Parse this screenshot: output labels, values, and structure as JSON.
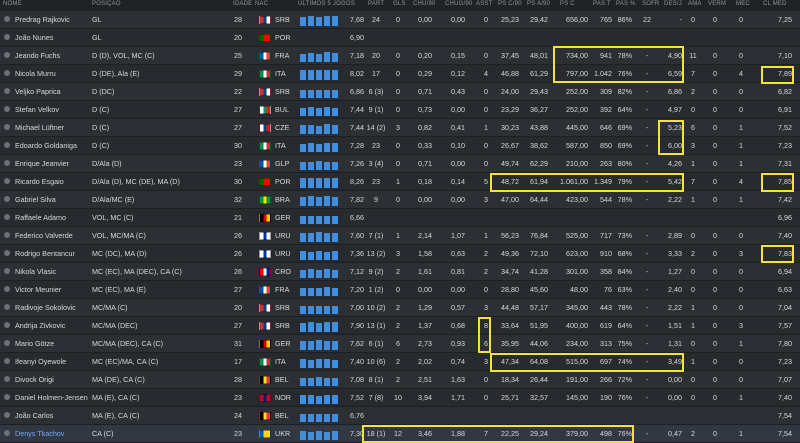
{
  "headers": {
    "name": "NOME",
    "pos": "POSIÇÃO",
    "age": "IDADE",
    "nat": "NAC",
    "last5": "ÚLTIMOS 5 JOGOS",
    "apps": "PART",
    "gls": "GLS",
    "shots90": "CHU/90",
    "sot90": "CHUG/90",
    "ast": "ASST",
    "psc90": "PS C/90",
    "psa90": "PS A/90",
    "psc": "PS C",
    "pst": "PAS T",
    "pspct": "PAS %",
    "sofr": "SOFR",
    "desj": "DES/J",
    "ama": "AMA",
    "verm": "VERM",
    "mec": "MEC",
    "clmed": "CL MED"
  },
  "flag_colors": {
    "SRB": [
      "#c6363c",
      "#0c4076",
      "#ffffff"
    ],
    "POR": [
      "#006600",
      "#ff0000",
      "#ff0000"
    ],
    "FRA": [
      "#0055a4",
      "#ffffff",
      "#ef4135"
    ],
    "ITA": [
      "#009246",
      "#ffffff",
      "#ce2b37"
    ],
    "BUL": [
      "#ffffff",
      "#00966e",
      "#d62612"
    ],
    "CZE": [
      "#ffffff",
      "#11457e",
      "#d7141a"
    ],
    "GLP": [
      "#0055a4",
      "#ffffff",
      "#ef4135"
    ],
    "BRA": [
      "#009c3b",
      "#ffdf00",
      "#009c3b"
    ],
    "GER": [
      "#000000",
      "#dd0000",
      "#ffce00"
    ],
    "URU": [
      "#ffffff",
      "#0038a8",
      "#ffffff"
    ],
    "CRO": [
      "#ff0000",
      "#ffffff",
      "#171796"
    ],
    "BEL": [
      "#000000",
      "#fdda24",
      "#ef3340"
    ],
    "NOR": [
      "#ba0c2f",
      "#00205b",
      "#ba0c2f"
    ],
    "UKR": [
      "#0057b7",
      "#ffd700",
      "#ffd700"
    ]
  },
  "rows": [
    {
      "name": "Predrag Rajkovic",
      "pos": "GL",
      "age": "28",
      "nat": "SRB",
      "last5": [
        0.75,
        0.8,
        0.75,
        0.85,
        0.8
      ],
      "form": "7,68",
      "apps": "24",
      "gls": "0",
      "shots90": "0,00",
      "sot90": "0,00",
      "ast": "0",
      "psc90": "25,23",
      "psa90": "29,42",
      "psc": "656,00",
      "pst": "765",
      "pspct": "86%",
      "sofr": "22",
      "desj": "-",
      "ama": "0",
      "verm": "0",
      "mec": "0",
      "clmed": "7,25"
    },
    {
      "name": "João Nunes",
      "pos": "GL",
      "age": "20",
      "nat": "POR",
      "last5": [
        0,
        0,
        0,
        0,
        0
      ],
      "form": "6,90",
      "apps": "",
      "gls": "",
      "shots90": "",
      "sot90": "",
      "ast": "",
      "psc90": "",
      "psa90": "",
      "psc": "",
      "pst": "",
      "pspct": "",
      "sofr": "",
      "desj": "",
      "ama": "",
      "verm": "",
      "mec": "",
      "clmed": ""
    },
    {
      "name": "Jeando Fuchs",
      "pos": "D (D), VOL, MC (C)",
      "age": "25",
      "nat": "FRA",
      "last5": [
        0.7,
        0.75,
        0.7,
        0.8,
        0.75
      ],
      "form": "7,18",
      "apps": "20",
      "gls": "0",
      "shots90": "0,20",
      "sot90": "0,15",
      "ast": "0",
      "psc90": "37,45",
      "psa90": "48,01",
      "psc": "734,00",
      "pst": "941",
      "pspct": "78%",
      "sofr": "-",
      "desj": "4,90",
      "ama": "11",
      "verm": "0",
      "mec": "0",
      "clmed": "7,10"
    },
    {
      "name": "Nicola Murru",
      "pos": "D (DE), Ala (E)",
      "age": "29",
      "nat": "ITA",
      "last5": [
        0.8,
        0.85,
        0.8,
        0.85,
        0.8
      ],
      "form": "8,02",
      "apps": "17",
      "gls": "0",
      "shots90": "0,29",
      "sot90": "0,12",
      "ast": "4",
      "psc90": "46,88",
      "psa90": "61,29",
      "psc": "797,00",
      "pst": "1.042",
      "pspct": "76%",
      "sofr": "-",
      "desj": "6,59",
      "ama": "7",
      "verm": "0",
      "mec": "4",
      "clmed": "7,89"
    },
    {
      "name": "Veljko Paprica",
      "pos": "D (DC)",
      "age": "22",
      "nat": "SRB",
      "last5": [
        0.65,
        0.7,
        0.7,
        0.65,
        0.7
      ],
      "form": "6,86",
      "apps": "6 (3)",
      "gls": "0",
      "shots90": "0,71",
      "sot90": "0,43",
      "ast": "0",
      "psc90": "24,00",
      "psa90": "29,43",
      "psc": "252,00",
      "pst": "309",
      "pspct": "82%",
      "sofr": "-",
      "desj": "6,86",
      "ama": "2",
      "verm": "0",
      "mec": "0",
      "clmed": "6,82"
    },
    {
      "name": "Stefan Velkov",
      "pos": "D (C)",
      "age": "27",
      "nat": "BUL",
      "last5": [
        0.7,
        0.75,
        0.7,
        0.75,
        0.7
      ],
      "form": "7,44",
      "apps": "9 (1)",
      "gls": "0",
      "shots90": "0,73",
      "sot90": "0,00",
      "ast": "0",
      "psc90": "23,29",
      "psa90": "36,27",
      "psc": "252,00",
      "pst": "392",
      "pspct": "64%",
      "sofr": "-",
      "desj": "4,97",
      "ama": "0",
      "verm": "0",
      "mec": "0",
      "clmed": "6,91"
    },
    {
      "name": "Michael Lüftner",
      "pos": "D (C)",
      "age": "27",
      "nat": "CZE",
      "last5": [
        0.75,
        0.75,
        0.7,
        0.8,
        0.75
      ],
      "form": "7,44",
      "apps": "14 (2)",
      "gls": "3",
      "shots90": "0,82",
      "sot90": "0,41",
      "ast": "1",
      "psc90": "30,23",
      "psa90": "43,88",
      "psc": "445,00",
      "pst": "646",
      "pspct": "69%",
      "sofr": "-",
      "desj": "5,23",
      "ama": "6",
      "verm": "0",
      "mec": "1",
      "clmed": "7,52"
    },
    {
      "name": "Edoardo Goldaniga",
      "pos": "D (C)",
      "age": "30",
      "nat": "ITA",
      "last5": [
        0.7,
        0.75,
        0.7,
        0.75,
        0.75
      ],
      "form": "7,28",
      "apps": "23",
      "gls": "0",
      "shots90": "0,33",
      "sot90": "0,10",
      "ast": "0",
      "psc90": "26,67",
      "psa90": "38,62",
      "psc": "587,00",
      "pst": "850",
      "pspct": "69%",
      "sofr": "-",
      "desj": "6,00",
      "ama": "3",
      "verm": "0",
      "mec": "1",
      "clmed": "7,23"
    },
    {
      "name": "Enrique Jeanvier",
      "pos": "D/Ala (D)",
      "age": "23",
      "nat": "GLP",
      "last5": [
        0.7,
        0.7,
        0.75,
        0.7,
        0.7
      ],
      "form": "7,26",
      "apps": "3 (4)",
      "gls": "0",
      "shots90": "0,71",
      "sot90": "0,00",
      "ast": "0",
      "psc90": "49,74",
      "psa90": "62,29",
      "psc": "210,00",
      "pst": "263",
      "pspct": "80%",
      "sofr": "-",
      "desj": "4,26",
      "ama": "1",
      "verm": "0",
      "mec": "1",
      "clmed": "7,31"
    },
    {
      "name": "Ricardo Esgaio",
      "pos": "D/Ala (D), MC (DE), MA (D)",
      "age": "30",
      "nat": "POR",
      "last5": [
        0.8,
        0.85,
        0.8,
        0.85,
        0.85
      ],
      "form": "8,26",
      "apps": "23",
      "gls": "1",
      "shots90": "0,18",
      "sot90": "0,14",
      "ast": "5",
      "psc90": "48,72",
      "psa90": "61,94",
      "psc": "1.061,00",
      "pst": "1.349",
      "pspct": "79%",
      "sofr": "-",
      "desj": "5,42",
      "ama": "7",
      "verm": "0",
      "mec": "4",
      "clmed": "7,85"
    },
    {
      "name": "Gabriel Silva",
      "pos": "D/Ala/MC (E)",
      "age": "32",
      "nat": "BRA",
      "last5": [
        0.75,
        0.8,
        0.75,
        0.8,
        0.75
      ],
      "form": "7,82",
      "apps": "9",
      "gls": "0",
      "shots90": "0,00",
      "sot90": "0,00",
      "ast": "3",
      "psc90": "47,00",
      "psa90": "64,44",
      "psc": "423,00",
      "pst": "544",
      "pspct": "78%",
      "sofr": "-",
      "desj": "2,22",
      "ama": "1",
      "verm": "0",
      "mec": "1",
      "clmed": "7,42"
    },
    {
      "name": "Raffaele Adamo",
      "pos": "VOL, MC (C)",
      "age": "21",
      "nat": "GER",
      "last5": [
        0.65,
        0.7,
        0.65,
        0.7,
        0.65
      ],
      "form": "6,66",
      "apps": "",
      "gls": "",
      "shots90": "",
      "sot90": "",
      "ast": "",
      "psc90": "",
      "psa90": "",
      "psc": "",
      "pst": "",
      "pspct": "",
      "sofr": "",
      "desj": "",
      "ama": "",
      "verm": "",
      "mec": "",
      "clmed": "6,96"
    },
    {
      "name": "Federico Valverde",
      "pos": "VOL, MC/MA (C)",
      "age": "26",
      "nat": "URU",
      "last5": [
        0.75,
        0.75,
        0.8,
        0.75,
        0.75
      ],
      "form": "7,60",
      "apps": "7 (1)",
      "gls": "1",
      "shots90": "2,14",
      "sot90": "1,07",
      "ast": "1",
      "psc90": "56,23",
      "psa90": "76,84",
      "psc": "525,00",
      "pst": "717",
      "pspct": "73%",
      "sofr": "-",
      "desj": "2,89",
      "ama": "0",
      "verm": "0",
      "mec": "0",
      "clmed": "7,40"
    },
    {
      "name": "Rodrigo Bentancur",
      "pos": "MC (DC), MA (D)",
      "age": "26",
      "nat": "URU",
      "last5": [
        0.75,
        0.7,
        0.75,
        0.7,
        0.75
      ],
      "form": "7,36",
      "apps": "13 (2)",
      "gls": "3",
      "shots90": "1,58",
      "sot90": "0,63",
      "ast": "2",
      "psc90": "49,36",
      "psa90": "72,10",
      "psc": "623,00",
      "pst": "910",
      "pspct": "68%",
      "sofr": "-",
      "desj": "3,33",
      "ama": "2",
      "verm": "0",
      "mec": "3",
      "clmed": "7,83"
    },
    {
      "name": "Nikola Vlasic",
      "pos": "MC (EC), MA (DEC), CA (C)",
      "age": "26",
      "nat": "CRO",
      "last5": [
        0.7,
        0.75,
        0.7,
        0.75,
        0.7
      ],
      "form": "7,12",
      "apps": "9 (2)",
      "gls": "2",
      "shots90": "1,61",
      "sot90": "0,81",
      "ast": "2",
      "psc90": "34,74",
      "psa90": "41,28",
      "psc": "301,00",
      "pst": "358",
      "pspct": "84%",
      "sofr": "-",
      "desj": "1,27",
      "ama": "0",
      "verm": "0",
      "mec": "0",
      "clmed": "6,94"
    },
    {
      "name": "Victor Meunier",
      "pos": "MC (EC), MA (E)",
      "age": "27",
      "nat": "FRA",
      "last5": [
        0.7,
        0.7,
        0.7,
        0.75,
        0.7
      ],
      "form": "7,20",
      "apps": "1 (2)",
      "gls": "0",
      "shots90": "0,00",
      "sot90": "0,00",
      "ast": "0",
      "psc90": "28,80",
      "psa90": "45,60",
      "psc": "48,00",
      "pst": "76",
      "pspct": "63%",
      "sofr": "-",
      "desj": "2,40",
      "ama": "0",
      "verm": "0",
      "mec": "0",
      "clmed": "6,63"
    },
    {
      "name": "Radivoje Sokolovic",
      "pos": "MC/MA (C)",
      "age": "20",
      "nat": "SRB",
      "last5": [
        0.7,
        0.7,
        0.7,
        0.7,
        0.7
      ],
      "form": "7,00",
      "apps": "10 (2)",
      "gls": "2",
      "shots90": "1,29",
      "sot90": "0,57",
      "ast": "3",
      "psc90": "44,48",
      "psa90": "57,17",
      "psc": "345,00",
      "pst": "443",
      "pspct": "78%",
      "sofr": "-",
      "desj": "2,22",
      "ama": "1",
      "verm": "0",
      "mec": "0",
      "clmed": "7,04"
    },
    {
      "name": "Andrija Zivkovic",
      "pos": "MC/MA (DEC)",
      "age": "27",
      "nat": "SRB",
      "last5": [
        0.75,
        0.8,
        0.75,
        0.8,
        0.8
      ],
      "form": "7,90",
      "apps": "13 (1)",
      "gls": "2",
      "shots90": "1,37",
      "sot90": "0,68",
      "ast": "8",
      "psc90": "33,64",
      "psa90": "51,95",
      "psc": "400,00",
      "pst": "619",
      "pspct": "64%",
      "sofr": "-",
      "desj": "1,51",
      "ama": "1",
      "verm": "0",
      "mec": "3",
      "clmed": "7,57"
    },
    {
      "name": "Mario Götze",
      "pos": "MC/MA (DEC), CA (C)",
      "age": "31",
      "nat": "GER",
      "last5": [
        0.75,
        0.75,
        0.8,
        0.75,
        0.75
      ],
      "form": "7,62",
      "apps": "6 (1)",
      "gls": "6",
      "shots90": "2,73",
      "sot90": "0,93",
      "ast": "6",
      "psc90": "35,95",
      "psa90": "44,06",
      "psc": "234,00",
      "pst": "313",
      "pspct": "75%",
      "sofr": "-",
      "desj": "1,31",
      "ama": "0",
      "verm": "0",
      "mec": "1",
      "clmed": "7,80"
    },
    {
      "name": "Ifeanyi Oyewole",
      "pos": "MC (EC)/MA, CA (C)",
      "age": "17",
      "nat": "ITA",
      "last5": [
        0.75,
        0.7,
        0.75,
        0.75,
        0.7
      ],
      "form": "7,40",
      "apps": "10 (6)",
      "gls": "2",
      "shots90": "2,02",
      "sot90": "0,74",
      "ast": "3",
      "psc90": "47,34",
      "psa90": "64,08",
      "psc": "515,00",
      "pst": "697",
      "pspct": "74%",
      "sofr": "-",
      "desj": "3,49",
      "ama": "1",
      "verm": "0",
      "mec": "0",
      "clmed": "7,23"
    },
    {
      "name": "Divock Origi",
      "pos": "MA (DE), CA (C)",
      "age": "28",
      "nat": "BEL",
      "last5": [
        0.7,
        0.7,
        0.75,
        0.7,
        0.7
      ],
      "form": "7,08",
      "apps": "8 (1)",
      "gls": "2",
      "shots90": "2,51",
      "sot90": "1,63",
      "ast": "0",
      "psc90": "18,34",
      "psa90": "26,44",
      "psc": "191,00",
      "pst": "266",
      "pspct": "72%",
      "sofr": "-",
      "desj": "0,00",
      "ama": "0",
      "verm": "0",
      "mec": "0",
      "clmed": "7,07"
    },
    {
      "name": "Daniel Holmen-Jensen",
      "pos": "MA (E), CA (C)",
      "age": "23",
      "nat": "NOR",
      "last5": [
        0.75,
        0.75,
        0.7,
        0.75,
        0.75
      ],
      "form": "7,52",
      "apps": "7 (8)",
      "gls": "10",
      "shots90": "3,94",
      "sot90": "1,71",
      "ast": "0",
      "psc90": "25,71",
      "psa90": "32,57",
      "psc": "145,00",
      "pst": "190",
      "pspct": "76%",
      "sofr": "-",
      "desj": "0,00",
      "ama": "0",
      "verm": "0",
      "mec": "1",
      "clmed": "7,40"
    },
    {
      "name": "João Carlos",
      "pos": "MA (E), CA (C)",
      "age": "24",
      "nat": "BEL",
      "last5": [
        0.7,
        0.65,
        0.7,
        0.65,
        0.7
      ],
      "form": "6,76",
      "apps": "",
      "gls": "",
      "shots90": "",
      "sot90": "",
      "ast": "",
      "psc90": "",
      "psa90": "",
      "psc": "",
      "pst": "",
      "pspct": "",
      "sofr": "",
      "desj": "",
      "ama": "",
      "verm": "",
      "mec": "",
      "clmed": "7,54"
    },
    {
      "name": "Denys Tkachov",
      "pos": "CA (C)",
      "age": "23",
      "nat": "UKR",
      "last5": [
        0.75,
        0.7,
        0.75,
        0.7,
        0.75
      ],
      "form": "7,30",
      "apps": "18 (1)",
      "gls": "12",
      "shots90": "3,46",
      "sot90": "1,88",
      "ast": "7",
      "psc90": "22,25",
      "psa90": "29,24",
      "psc": "379,00",
      "pst": "498",
      "pspct": "76%",
      "sofr": "-",
      "desj": "0,47",
      "ama": "2",
      "verm": "0",
      "mec": "1",
      "clmed": "7,54"
    }
  ],
  "highlighted_row": 23
}
